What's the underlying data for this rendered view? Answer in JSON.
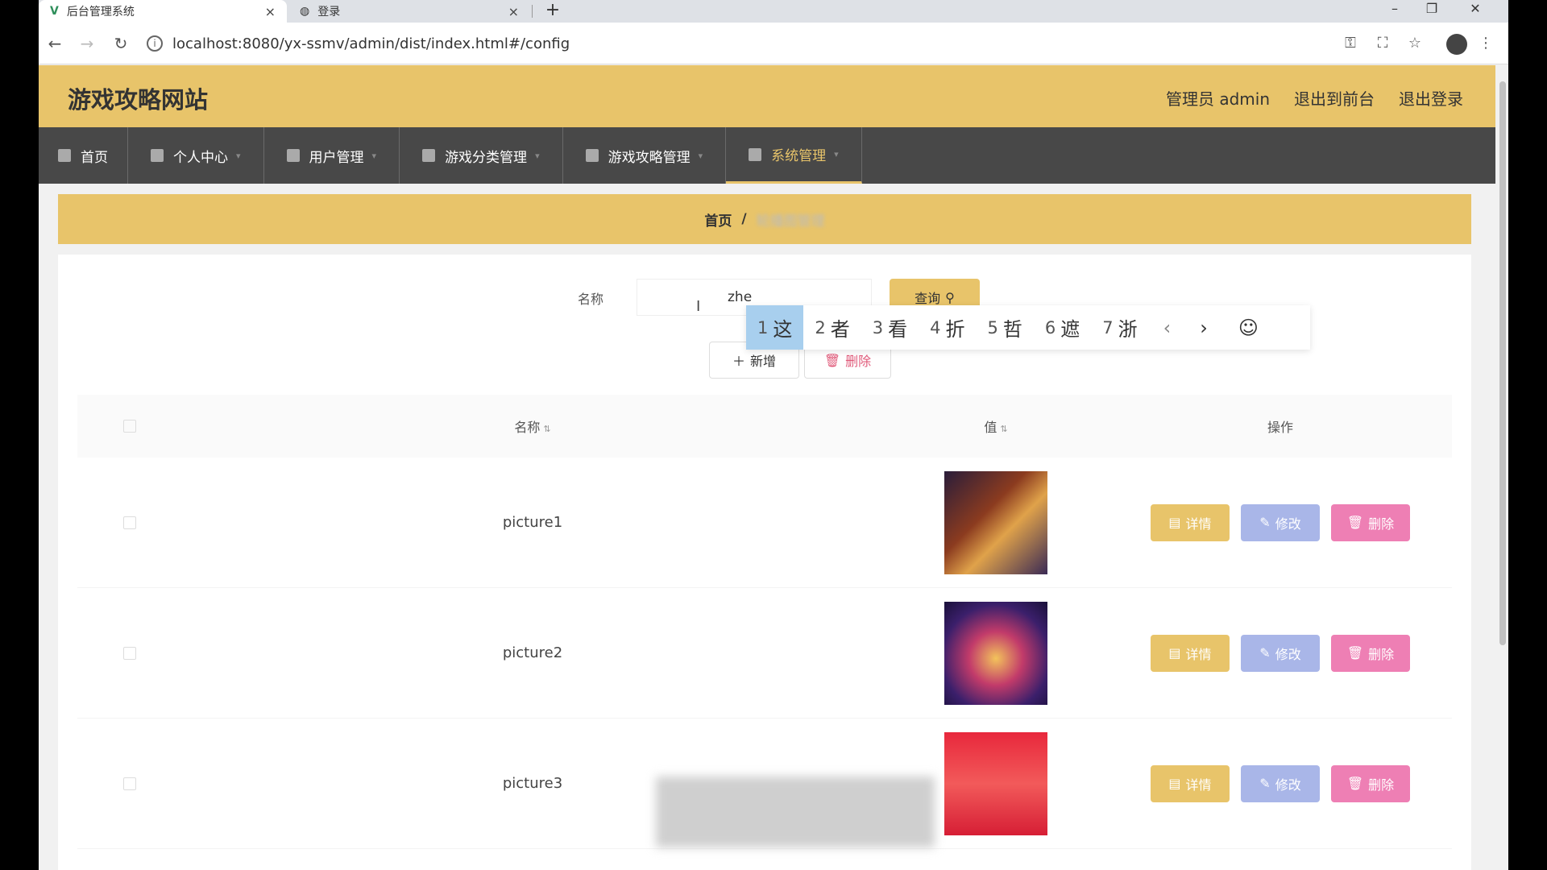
{
  "browser": {
    "tabs": [
      {
        "title": "后台管理系统",
        "close": "×"
      },
      {
        "title": "登录",
        "close": "×"
      }
    ],
    "new_tab": "+",
    "url": "localhost:8080/yx-ssmv/admin/dist/index.html#/config",
    "controls": {
      "minimize": "–",
      "restore": "❐",
      "close": "✕"
    }
  },
  "header": {
    "site_title": "游戏攻略网站",
    "admin_label": "管理员 admin",
    "back_to_front": "退出到前台",
    "logout": "退出登录"
  },
  "nav": {
    "items": [
      {
        "label": "首页"
      },
      {
        "label": "个人中心"
      },
      {
        "label": "用户管理"
      },
      {
        "label": "游戏分类管理"
      },
      {
        "label": "游戏攻略管理"
      },
      {
        "label": "系统管理"
      }
    ]
  },
  "breadcrumb": {
    "home": "首页",
    "separator": "/",
    "current": "轮播图管理"
  },
  "search": {
    "label": "名称",
    "value": "zhe",
    "query_button": "查询"
  },
  "ime": {
    "candidates": [
      {
        "n": "1",
        "c": "这"
      },
      {
        "n": "2",
        "c": "者"
      },
      {
        "n": "3",
        "c": "看"
      },
      {
        "n": "4",
        "c": "折"
      },
      {
        "n": "5",
        "c": "哲"
      },
      {
        "n": "6",
        "c": "遮"
      },
      {
        "n": "7",
        "c": "浙"
      }
    ],
    "prev": "‹",
    "next": "›",
    "emoji": "☺"
  },
  "toolbar": {
    "add_label": "新增",
    "delete_label": "删除"
  },
  "table": {
    "headers": {
      "name": "名称",
      "value": "值",
      "operation": "操作"
    },
    "rows": [
      {
        "name": "picture1"
      },
      {
        "name": "picture2"
      },
      {
        "name": "picture3"
      }
    ],
    "actions": {
      "detail": "详情",
      "edit": "修改",
      "remove": "删除"
    }
  },
  "colors": {
    "accent": "#e8c46a",
    "nav_bg": "#484848",
    "edit_btn": "#a9b6e8",
    "remove_btn": "#ee7fb4"
  }
}
